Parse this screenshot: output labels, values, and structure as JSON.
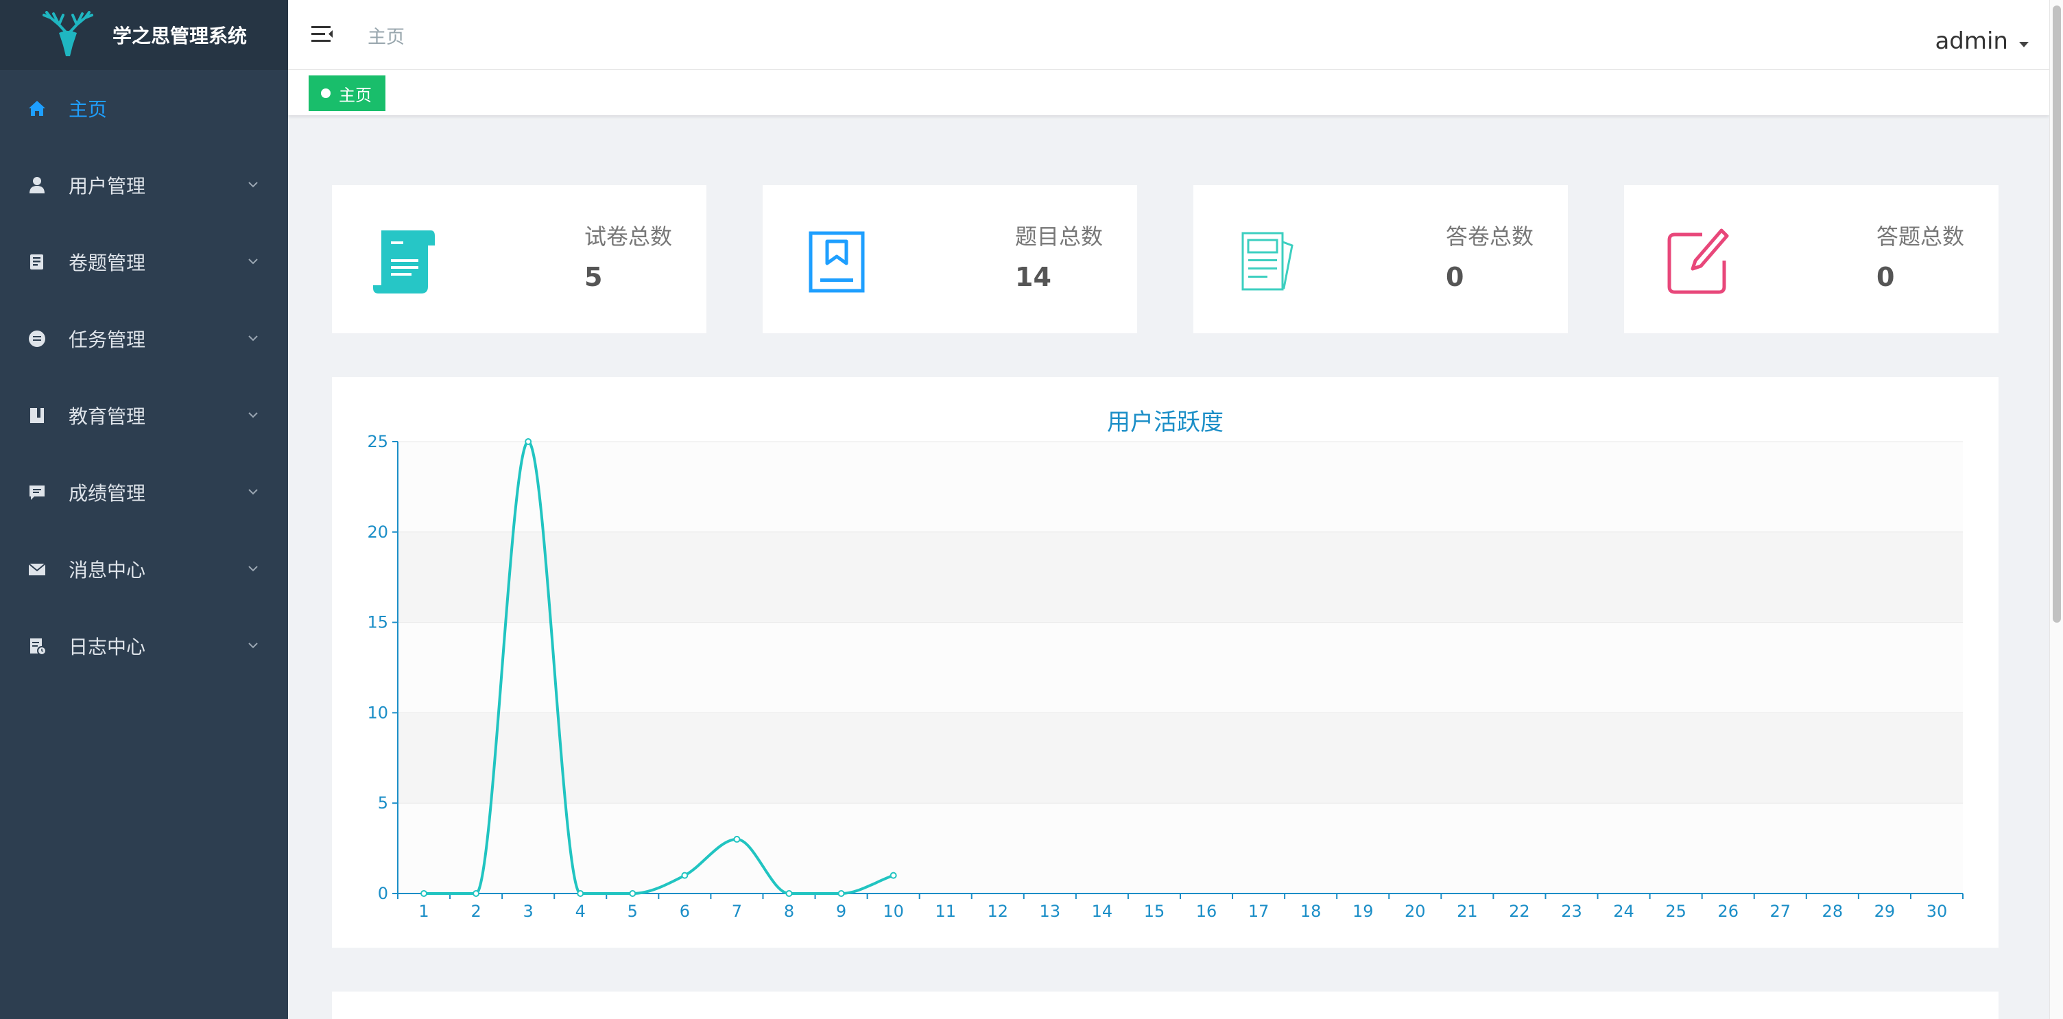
{
  "app": {
    "title": "学之思管理系统"
  },
  "sidebar": {
    "items": [
      {
        "label": "主页",
        "icon": "home-icon"
      },
      {
        "label": "用户管理",
        "icon": "user-icon"
      },
      {
        "label": "卷题管理",
        "icon": "book-icon"
      },
      {
        "label": "任务管理",
        "icon": "task-icon"
      },
      {
        "label": "教育管理",
        "icon": "education-icon"
      },
      {
        "label": "成绩管理",
        "icon": "message-icon"
      },
      {
        "label": "消息中心",
        "icon": "mail-icon"
      },
      {
        "label": "日志中心",
        "icon": "log-icon"
      }
    ]
  },
  "header": {
    "breadcrumb": "主页",
    "user": "admin"
  },
  "tabs": [
    {
      "label": "主页"
    }
  ],
  "colors": {
    "sidebar_bg": "#2d3e50",
    "active": "#1e9fff",
    "tab_green": "#19be6b",
    "line": "#21c4c1",
    "axis": "#1b8ec7"
  },
  "cards": [
    {
      "title": "试卷总数",
      "value": "5",
      "icon": "paper-scroll-icon",
      "color": "#26c6c6"
    },
    {
      "title": "题目总数",
      "value": "14",
      "icon": "bookmark-book-icon",
      "color": "#1e9fff"
    },
    {
      "title": "答卷总数",
      "value": "0",
      "icon": "documents-icon",
      "color": "#3ccfc0"
    },
    {
      "title": "答题总数",
      "value": "0",
      "icon": "edit-icon",
      "color": "#e8477a"
    }
  ],
  "chart": {
    "title": "用户活跃度"
  },
  "chart_data": {
    "type": "line",
    "title": "用户活跃度",
    "x": [
      "1",
      "2",
      "3",
      "4",
      "5",
      "6",
      "7",
      "8",
      "9",
      "10",
      "11",
      "12",
      "13",
      "14",
      "15",
      "16",
      "17",
      "18",
      "19",
      "20",
      "21",
      "22",
      "23",
      "24",
      "25",
      "26",
      "27",
      "28",
      "29",
      "30"
    ],
    "y": [
      0,
      0,
      25,
      0,
      0,
      1,
      3,
      0,
      0,
      1
    ],
    "yticks": [
      0,
      5,
      10,
      15,
      20,
      25
    ],
    "ylim": [
      0,
      25
    ],
    "smooth": true,
    "grid": true
  }
}
